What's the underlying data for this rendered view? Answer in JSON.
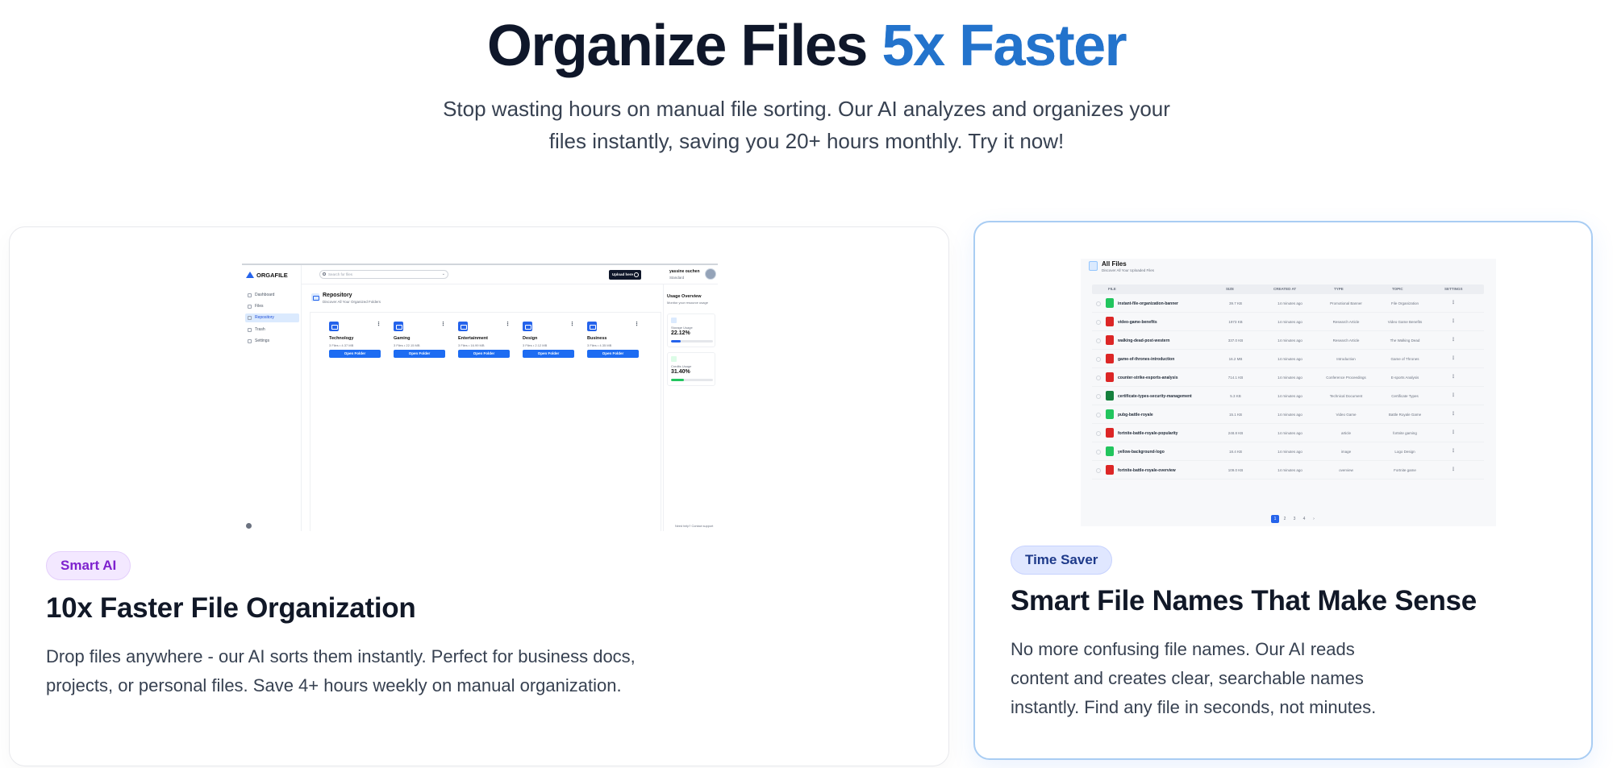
{
  "hero": {
    "title_main": "Organize Files",
    "title_accent": "5x Faster",
    "subtitle_line1": "Stop wasting hours on manual file sorting. Our AI analyzes and organizes your",
    "subtitle_line2": "files instantly, saving you 20+ hours monthly. Try it now!"
  },
  "colors": {
    "accent": "#2373cc",
    "primary_button": "#1d6cf2",
    "smart_ai_badge": "#7e22ce",
    "time_saver_badge": "#1e3a8a",
    "highlight_border": "#a9cdf3"
  },
  "card_left": {
    "badge": "Smart AI",
    "title": "10x Faster File Organization",
    "desc_line1": "Drop files anywhere - our AI sorts them instantly. Perfect for business docs,",
    "desc_line2": "projects, or personal files. Save 4+ hours weekly on manual organization.",
    "mock": {
      "logo": "ORGAFILE",
      "nav": [
        {
          "label": "Dashboard",
          "icon": "grid-icon"
        },
        {
          "label": "Files",
          "icon": "file-icon"
        },
        {
          "label": "Repository",
          "icon": "folder-icon",
          "active": true
        },
        {
          "label": "Trash",
          "icon": "trash-icon"
        },
        {
          "label": "Settings",
          "icon": "gear-icon"
        }
      ],
      "search_placeholder": "Search for files",
      "upload_label": "Upload here",
      "user_name": "yassine ouchen",
      "user_plan": "Standard",
      "section_title": "Repository",
      "section_sub": "Discover All Your Organized Folders",
      "folders": [
        {
          "name": "Technology",
          "meta": "3 Files  •  4.37 MB",
          "button": "Open Folder"
        },
        {
          "name": "Gaming",
          "meta": "3 Files  •  22.15 MB",
          "button": "Open Folder"
        },
        {
          "name": "Entertainment",
          "meta": "3 Files  •  16.99 MB",
          "button": "Open Folder"
        },
        {
          "name": "Design",
          "meta": "3 Files  •  2.12 MB",
          "button": "Open Folder"
        },
        {
          "name": "Business",
          "meta": "3 Files  •  4.35 MB",
          "button": "Open Folder"
        }
      ],
      "usage_title": "Usage Overview",
      "usage_sub": "Monitor your resource usage",
      "usage": [
        {
          "label": "Storage Usage",
          "value": "22.12%",
          "fraction": 0.2212,
          "color": "#2563eb"
        },
        {
          "label": "Credits Usage",
          "value": "31.40%",
          "fraction": 0.314,
          "color": "#22c55e"
        }
      ],
      "help": "Need help? Contact support"
    }
  },
  "card_right": {
    "badge": "Time Saver",
    "title": "Smart File Names That Make Sense",
    "desc_line1": "No more confusing file names. Our AI reads",
    "desc_line2": "content and creates clear, searchable names",
    "desc_line3": "instantly. Find any file in seconds, not minutes.",
    "mock": {
      "title": "All Files",
      "subtitle": "Discover All Your Uploaded Files",
      "columns": [
        "FILE",
        "SIZE",
        "CREATED AT",
        "TYPE",
        "TOPIC",
        "SETTINGS"
      ],
      "rows": [
        {
          "name": "instant-file-organization-banner",
          "size": "39.7 KB",
          "created": "14 minutes ago",
          "type": "Promotional Banner",
          "topic": "File Organization",
          "kind": "image"
        },
        {
          "name": "video-game-benefits",
          "size": "1973 KB",
          "created": "14 minutes ago",
          "type": "Research Article",
          "topic": "Video Game Benefits",
          "kind": "pdf"
        },
        {
          "name": "walking-dead-post-western",
          "size": "337.0 KB",
          "created": "14 minutes ago",
          "type": "Research Article",
          "topic": "The Walking Dead",
          "kind": "pdf"
        },
        {
          "name": "game-of-thrones-introduction",
          "size": "16.2 MB",
          "created": "14 minutes ago",
          "type": "Introduction",
          "topic": "Game of Thrones",
          "kind": "pdf"
        },
        {
          "name": "counter-strike-esports-analysis",
          "size": "714.1 KB",
          "created": "14 minutes ago",
          "type": "Conference Proceedings",
          "topic": "E-sports Analysis",
          "kind": "pdf"
        },
        {
          "name": "certificate-types-security-management",
          "size": "5.3 KB",
          "created": "14 minutes ago",
          "type": "Technical Document",
          "topic": "Certificate Types",
          "kind": "sheet"
        },
        {
          "name": "pubg-battle-royale",
          "size": "15.1 KB",
          "created": "14 minutes ago",
          "type": "Video Game",
          "topic": "Battle Royale Game",
          "kind": "image"
        },
        {
          "name": "fortnite-battle-royale-popularity",
          "size": "248.8 KB",
          "created": "14 minutes ago",
          "type": "article",
          "topic": "fortnite gaming",
          "kind": "pdf"
        },
        {
          "name": "yellow-background-logo",
          "size": "18.4 KB",
          "created": "14 minutes ago",
          "type": "image",
          "topic": "Logo Design",
          "kind": "image"
        },
        {
          "name": "fortnite-battle-royale-overview",
          "size": "109.0 KB",
          "created": "14 minutes ago",
          "type": "overview",
          "topic": "Fortnite game",
          "kind": "pdf"
        }
      ],
      "pages": [
        "1",
        "2",
        "3",
        "4",
        "›"
      ],
      "current_page": "1"
    }
  }
}
